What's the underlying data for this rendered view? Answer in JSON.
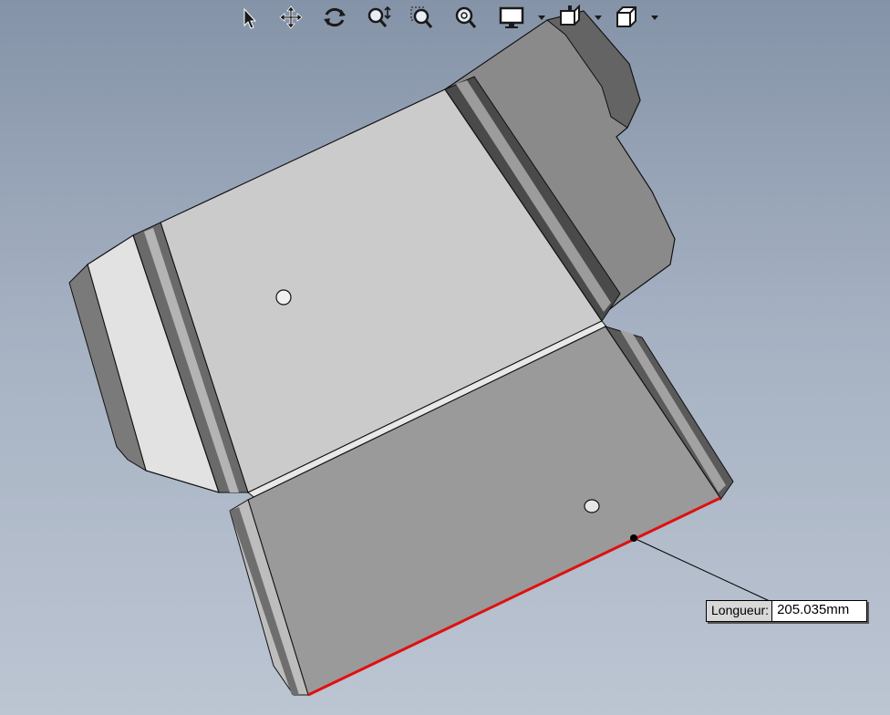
{
  "toolbar": {
    "tools": [
      {
        "icon": "select-arrow-icon",
        "tooltip": ""
      },
      {
        "icon": "pan-icon",
        "tooltip": ""
      },
      {
        "icon": "rotate-icon",
        "tooltip": ""
      },
      {
        "icon": "zoom-dynamic-icon",
        "tooltip": ""
      },
      {
        "icon": "zoom-window-icon",
        "tooltip": ""
      },
      {
        "icon": "zoom-fit-icon",
        "tooltip": ""
      },
      {
        "icon": "display-monitor-icon",
        "tooltip": ""
      },
      {
        "icon": "section-view-icon",
        "tooltip": ""
      },
      {
        "icon": "view-cube-icon",
        "tooltip": ""
      }
    ]
  },
  "model": {
    "colors": {
      "panel_light": "#cbcbcb",
      "panel_mid": "#9a9a9a",
      "panel_dark": "#6e6e6e",
      "selected_edge": "#e01010",
      "leader_line": "#000000"
    }
  },
  "measurement": {
    "label": "Longueur:",
    "value": "205.035mm"
  }
}
